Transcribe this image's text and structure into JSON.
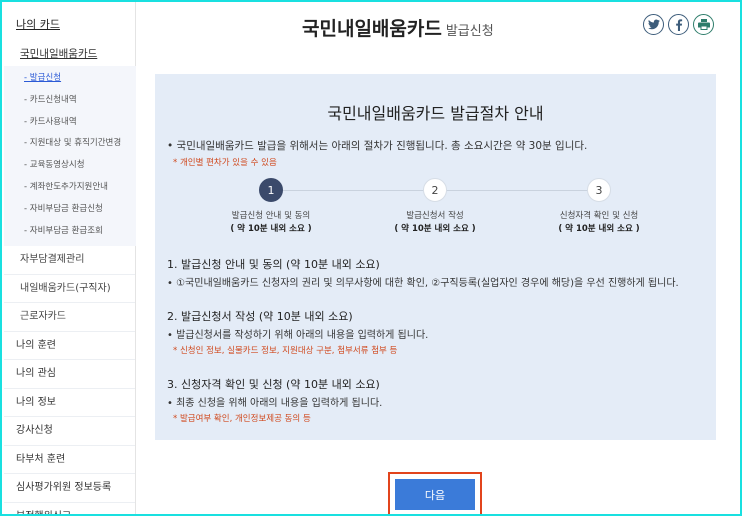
{
  "sidebar": {
    "top": "나의 카드",
    "sub": "국민내일배움카드",
    "list": [
      "- 발급신청",
      "- 카드신청내역",
      "- 카드사용내역",
      "- 지원대상 및 휴직기간변경",
      "- 교육동영상시청",
      "- 계좌한도추가지원안내",
      "- 자비부담금 환급신청",
      "- 자비부담금 환급조회"
    ],
    "items2": [
      "자부담결제관리",
      "내일배움카드(구직자)",
      "근로자카드"
    ],
    "items1": [
      "나의 훈련",
      "나의 관심",
      "나의 정보",
      "강사신청",
      "타부처 훈련",
      "심사평가위원 정보등록",
      "부정행위신고"
    ]
  },
  "header": {
    "title": "국민내일배움카드",
    "subtitle": "발급신청"
  },
  "social": [
    "twitter-icon",
    "facebook-icon",
    "print-icon"
  ],
  "panel": {
    "title": "국민내일배움카드 발급절차 안내",
    "intro": "• 국민내일배움카드 발급을 위해서는 아래의 절차가 진행됩니다. 총 소요시간은 약 30분 입니다.",
    "note": "* 개인별 편차가 있을 수 있음",
    "steps": [
      {
        "num": "1",
        "label": "발급신청 안내 및 동의",
        "time": "( 약 10분 내외 소요 )"
      },
      {
        "num": "2",
        "label": "발급신청서 작성",
        "time": "( 약 10분 내외 소요 )"
      },
      {
        "num": "3",
        "label": "신청자격 확인 및 신청",
        "time": "( 약 10분 내외 소요 )"
      }
    ],
    "sections": [
      {
        "heading": "1. 발급신청 안내 및 동의 (약 10분 내외 소요)",
        "text": "• ①국민내일배움카드 신청자의 권리 및 의무사항에 대한 확인, ②구직등록(실업자인 경우에 해당)을 우선 진행하게 됩니다.",
        "note": ""
      },
      {
        "heading": "2. 발급신청서 작성 (약 10분 내외 소요)",
        "text": "• 발급신청서를 작성하기 위해 아래의 내용을 입력하게 됩니다.",
        "note": "* 신청인 정보, 실물카드 정보, 지원대상 구분, 첨부서류 첨부 등"
      },
      {
        "heading": "3. 신청자격 확인 및 신청 (약 10분 내외 소요)",
        "text": "• 최종 신청을 위해 아래의 내용을 입력하게 됩니다.",
        "note": "* 발급여부 확인, 개인정보제공 동의 등"
      }
    ]
  },
  "next_button": "다음",
  "colors": {
    "accent": "#3b7bd9",
    "highlight_border": "#e2441c",
    "panel_bg": "#e4ecf7",
    "note": "#d04a1f"
  }
}
